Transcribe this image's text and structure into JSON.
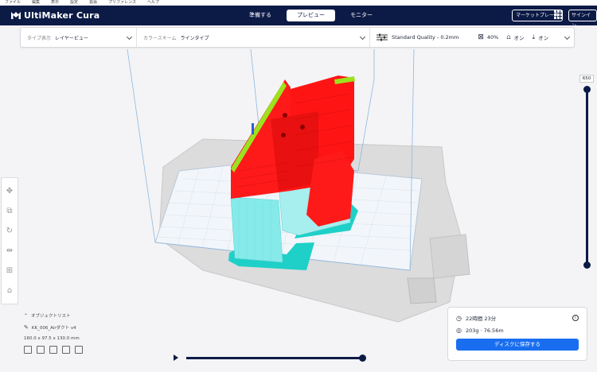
{
  "menubar": [
    "ファイル",
    "編集",
    "表示",
    "設定",
    "拡張",
    "プリファレンス",
    "ヘルプ"
  ],
  "app": {
    "brand": "UltiMaker Cura"
  },
  "stages": [
    {
      "label": "準備する",
      "active": false
    },
    {
      "label": "プレビュー",
      "active": true
    },
    {
      "label": "モニター",
      "active": false
    }
  ],
  "header": {
    "marketplace": "マーケットプレース",
    "signin": "サインイン"
  },
  "toolbar": {
    "view_type_label": "タイプ表示",
    "view_type_value": "レイヤービュー",
    "color_scheme_label": "カラースキーム",
    "color_scheme_value": "ラインタイプ",
    "quality": "Standard Quality - 0.2mm",
    "infill": "40%",
    "support": "オン",
    "adhesion": "オン"
  },
  "layer": {
    "current": "650",
    "slider_level": 1.0
  },
  "object": {
    "list_title": "オブジェクトリスト",
    "name": "KK_006_Airダクト v4",
    "dimensions": "160.0 x 97.5 x 130.0 mm"
  },
  "playback": {
    "progress": 1.0
  },
  "estimate": {
    "time": "22時間 23分",
    "material": "203g · 76.56m",
    "save_button": "ディスクに保存する"
  },
  "colors": {
    "brand": "#0c1a46",
    "accent": "#196ef0",
    "wall": "#ff1a1a",
    "support": "#7fe8e8",
    "skirt": "#1fd0c8",
    "infill": "#9be21e"
  }
}
